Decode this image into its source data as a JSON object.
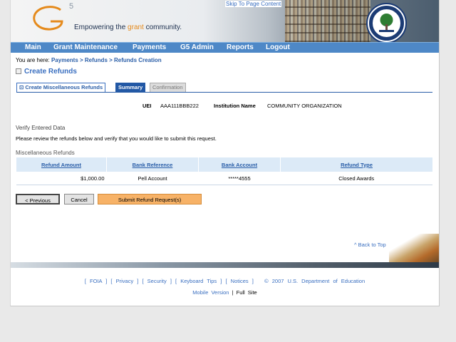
{
  "skip_link": "Skip To Page Content",
  "brand": {
    "logo_letter": "G",
    "logo_five": "5",
    "tagline_pre": "Empowering the ",
    "tagline_hl": "grant",
    "tagline_post": " community."
  },
  "nav": [
    "Main",
    "Grant Maintenance",
    "Payments",
    "G5 Admin",
    "Reports",
    "Logout"
  ],
  "breadcrumb": {
    "prefix": "You are here: ",
    "items": [
      "Payments",
      "Refunds",
      "Refunds Creation"
    ],
    "sep": " > "
  },
  "page_title": "Create Refunds",
  "tabs": [
    "Create Miscellaneous Refunds",
    "Summary",
    "Confirmation"
  ],
  "info": {
    "uei_label": "UEI",
    "uei_value": "AAA111BBB222",
    "inst_label": "Institution Name",
    "inst_value": "COMMUNITY ORGANIZATION"
  },
  "verify_heading": "Verify Entered Data",
  "verify_text": "Please review the refunds below and verify that you would like to submit this request.",
  "misc_heading": "Miscellaneous Refunds",
  "table": {
    "headers": [
      "Refund Amount",
      "Bank Reference",
      "Bank Account",
      "Refund Type"
    ],
    "rows": [
      [
        "$1,000.00",
        "Pell Account",
        "*****4555",
        "Closed Awards"
      ]
    ]
  },
  "buttons": {
    "previous": "< Previous",
    "cancel": "Cancel",
    "submit": "Submit Refund Request(s)"
  },
  "back_to_top": "^ Back to Top",
  "footer": {
    "links": [
      "FOIA",
      "Privacy",
      "Security",
      "Keyboard Tips",
      "Notices"
    ],
    "copyright": "© 2007 U.S. Department of Education",
    "mobile": "Mobile Version",
    "sep": "|",
    "full": "Full Site"
  },
  "colors": {
    "nav_bg": "#4e88c7",
    "link": "#2a5ea8",
    "submit_bg": "#f7b267"
  }
}
